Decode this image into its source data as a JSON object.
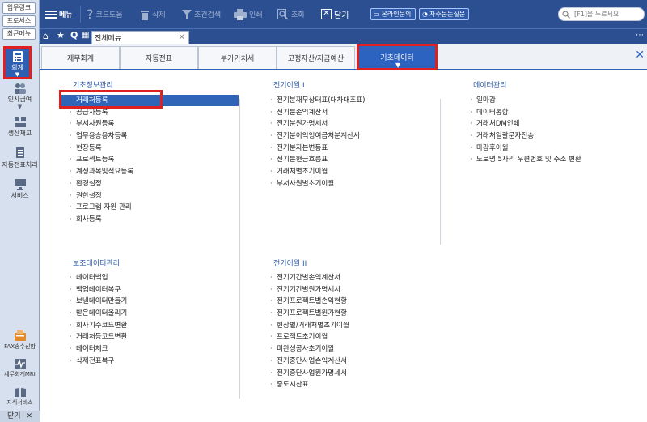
{
  "sidebar": {
    "top_buttons": [
      "업무링크",
      "프로세스",
      "최근메뉴"
    ],
    "items": [
      {
        "label": "회계",
        "icon": "calculator-icon",
        "active": true
      },
      {
        "label": "인사급여",
        "icon": "people-icon"
      },
      {
        "label": "생산재고",
        "icon": "boxes-icon"
      },
      {
        "label": "자동전표처리",
        "icon": "document-stack-icon"
      },
      {
        "label": "서비스",
        "icon": "monitor-icon"
      }
    ],
    "bottom_items": [
      {
        "label": "FAX송수신함",
        "icon": "fax-icon"
      },
      {
        "label": "세무회계MRI",
        "icon": "chart-pulse-icon"
      },
      {
        "label": "지식서비스",
        "icon": "book-icon"
      }
    ],
    "close_label": "닫기"
  },
  "toolbar": {
    "menu_label": "메뉴",
    "code_help": "코드도움",
    "delete": "삭제",
    "filter": "조건검색",
    "print": "인쇄",
    "search": "조회",
    "close": "닫기",
    "online_inquiry": "온라인문의",
    "faq": "자주묻는질문",
    "search_placeholder": "[F1]을 누르세요"
  },
  "tabstrip": {
    "open_tab": "전체메뉴"
  },
  "category_tabs": [
    {
      "label": "재무회계"
    },
    {
      "label": "자동전표"
    },
    {
      "label": "부가가치세"
    },
    {
      "label": "고정자산/자금예산"
    },
    {
      "label": "기초데이터",
      "active": true
    }
  ],
  "sections": {
    "basic_info": {
      "title": "기초정보관리",
      "items": [
        "거래처등록",
        "공급자등록",
        "부서사원등록",
        "업무용승용차등록",
        "현장등록",
        "프로젝트등록",
        "계정과목및적요등록",
        "환경설정",
        "권한설정",
        "프로그램 자원 관리",
        "회사등록"
      ],
      "selected": "거래처등록"
    },
    "carryover1": {
      "title": "전기이월 I",
      "items": [
        "전기분재무상태표(대차대조표)",
        "전기분손익계산서",
        "전기분원가명세서",
        "전기분이익잉여금처분계산서",
        "전기분자본변동표",
        "전기분현금흐름표",
        "거래처별초기이월",
        "부서사원별초기이월"
      ]
    },
    "data_mgmt": {
      "title": "데이터관리",
      "items": [
        "일마감",
        "데이터통합",
        "거래처DM인쇄",
        "거래처일괄문자전송",
        "마감후이월",
        "도로명 5자리 우편번호 및 주소 변환"
      ]
    },
    "aux_data": {
      "title": "보조데이터관리",
      "items": [
        "데이터백업",
        "백업데이터복구",
        "보낼데이터만들기",
        "받은데이터올리기",
        "회사기수코드변환",
        "거래처등코드변환",
        "데이터체크",
        "삭제전표복구"
      ]
    },
    "carryover2": {
      "title": "전기이월 II",
      "items": [
        "전기기간별손익계산서",
        "전기기간별원가명세서",
        "전기프로젝트별손익현황",
        "전기프로젝트별원가현황",
        "현장별/거래처별초기이월",
        "프로젝트초기이월",
        "미완성공사초기이월",
        "전기중단사업손익계산서",
        "전기중단사업원가명세서",
        "중도시산표"
      ]
    }
  },
  "colors": {
    "toolbar_bg": "#2c4f92",
    "accent": "#2c63c1",
    "highlight": "#e02020"
  }
}
